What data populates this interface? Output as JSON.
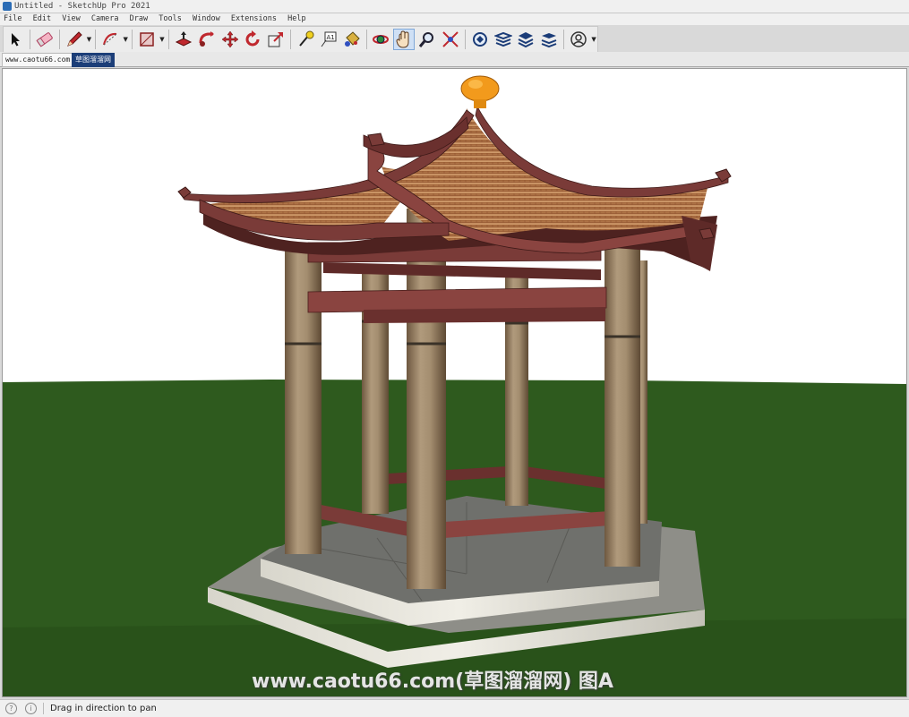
{
  "window": {
    "title": "Untitled - SketchUp Pro 2021"
  },
  "menu": [
    "File",
    "Edit",
    "View",
    "Camera",
    "Draw",
    "Tools",
    "Window",
    "Extensions",
    "Help"
  ],
  "toolbar": {
    "tools": [
      "select-tool",
      "eraser-tool",
      "pencil-tool",
      "arc-tool",
      "rectangle-tool",
      "push-pull-tool",
      "follow-me-tool",
      "move-tool",
      "rotate-tool",
      "scale-tool",
      "tape-measure-tool",
      "text-tool",
      "paint-bucket-tool",
      "orbit-tool",
      "pan-tool",
      "zoom-tool",
      "zoom-extents-tool",
      "warehouse-tool",
      "extension-warehouse-tool",
      "layout-tool",
      "extension-manager-tool",
      "account-tool"
    ],
    "active_tool": "pan-tool"
  },
  "tabs": [
    {
      "label": "www.caotu66.com"
    },
    {
      "label": "草图溜溜网"
    }
  ],
  "viewport": {
    "watermark": "www.caotu66.com(草图溜溜网) 图A",
    "colors": {
      "sky": "#ffffff",
      "ground": "#2e5a1e",
      "roof": "#7a3b38",
      "roof_tiles": "#c08550",
      "column": "#a89070",
      "finial": "#f29a1c",
      "base": "#8a8a86"
    }
  },
  "status": {
    "message": "Drag in direction to pan"
  }
}
